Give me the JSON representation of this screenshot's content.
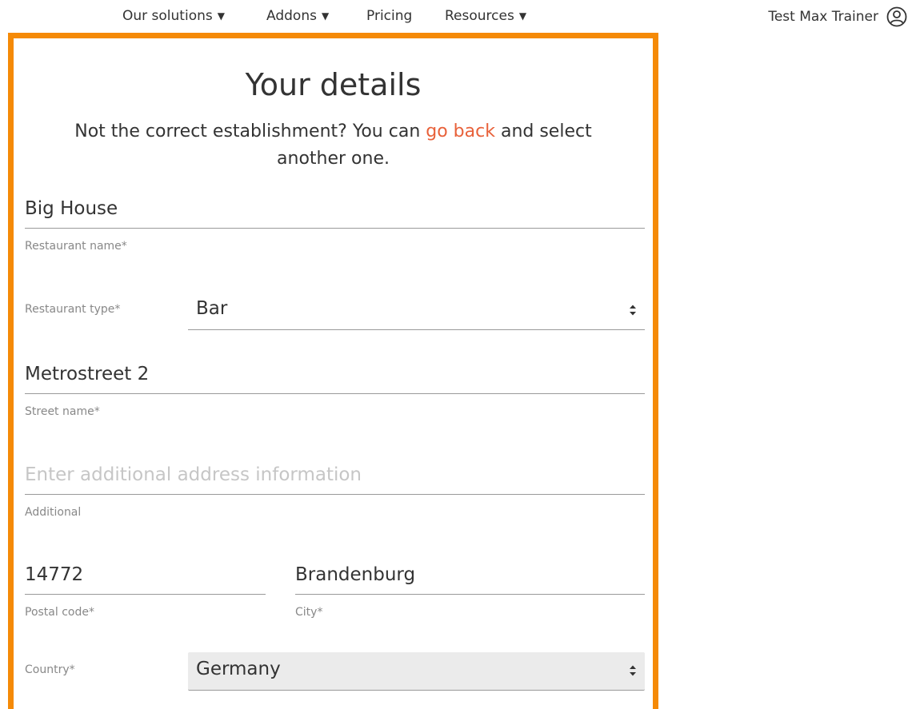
{
  "nav": {
    "items": [
      {
        "label": "Our solutions",
        "dropdown": true
      },
      {
        "label": "Addons",
        "dropdown": true
      },
      {
        "label": "Pricing",
        "dropdown": false
      },
      {
        "label": "Resources",
        "dropdown": true
      }
    ],
    "caret": "▼",
    "user_name": "Test Max Trainer",
    "user_icon": "user-circle-icon"
  },
  "form": {
    "title": "Your details",
    "subtitle_before": "Not the correct establishment? You can ",
    "subtitle_link": "go back",
    "subtitle_after": " and select another one.",
    "restaurant_name": {
      "value": "Big House",
      "label": "Restaurant name*"
    },
    "restaurant_type": {
      "label": "Restaurant type*",
      "value": "Bar"
    },
    "street": {
      "value": "Metrostreet 2",
      "label": "Street name*"
    },
    "additional": {
      "placeholder": "Enter additional address information",
      "label": "Additional"
    },
    "postal_code": {
      "value": "14772",
      "label": "Postal code*"
    },
    "city": {
      "value": "Brandenburg",
      "label": "City*"
    },
    "country": {
      "label": "Country*",
      "value": "Germany"
    }
  },
  "colors": {
    "frame": "#f58a07",
    "link": "#e8613a",
    "filled_select": "#ebebeb"
  }
}
